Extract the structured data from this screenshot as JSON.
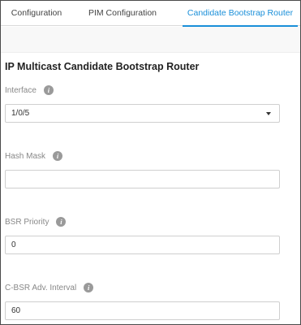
{
  "tabs": [
    {
      "label": "Configuration",
      "active": false
    },
    {
      "label": "PIM Configuration",
      "active": false
    },
    {
      "label": "Candidate Bootstrap Router",
      "active": true
    }
  ],
  "section": {
    "title": "IP Multicast Candidate Bootstrap Router"
  },
  "fields": {
    "interface": {
      "label": "Interface",
      "value": "1/0/5"
    },
    "hash_mask": {
      "label": "Hash Mask",
      "value": ""
    },
    "bsr_priority": {
      "label": "BSR Priority",
      "value": "0"
    },
    "cbsr_interval": {
      "label": "C-BSR Adv. Interval",
      "value": "60"
    }
  },
  "icons": {
    "info": "i"
  },
  "colors": {
    "accent": "#1a8fd9",
    "label": "#888888",
    "info_icon": "#9a9a9a"
  }
}
